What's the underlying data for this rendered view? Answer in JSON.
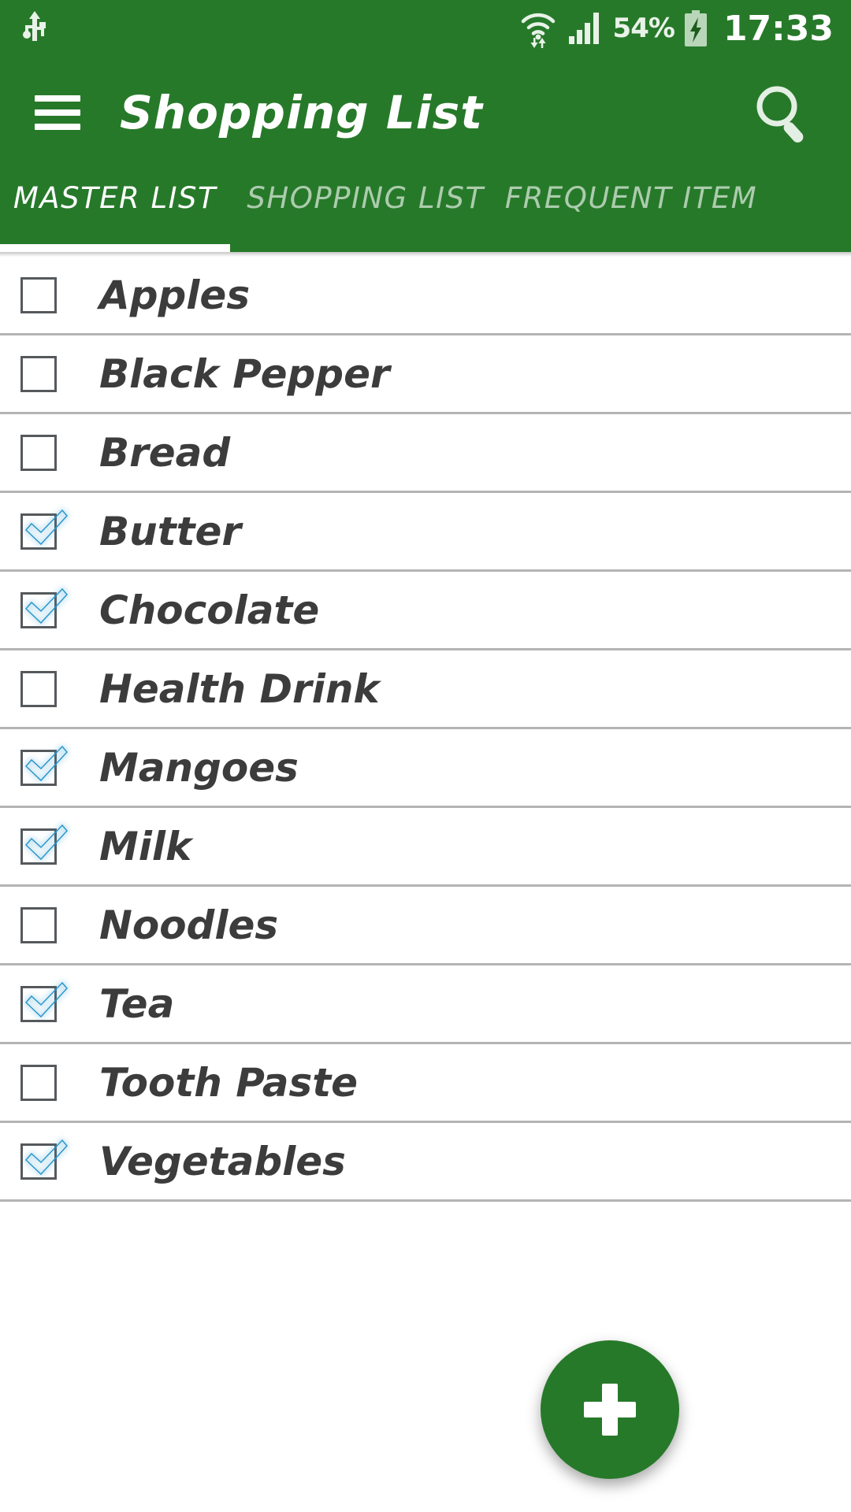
{
  "colors": {
    "brand_green": "#27792a",
    "check_blue": "#3bade3",
    "divider": "#b4b4b4",
    "text": "#3c3c3c"
  },
  "statusbar": {
    "usb_icon": "usb-icon",
    "wifi_icon": "wifi-icon",
    "signal_icon": "signal-bars-icon",
    "battery_percent": "54%",
    "battery_icon": "battery-charging-icon",
    "time": "17:33"
  },
  "appbar": {
    "menu_icon": "hamburger-menu-icon",
    "title": "Shopping List",
    "search_icon": "search-icon"
  },
  "tabs": [
    {
      "label": "MASTER LIST",
      "active": true
    },
    {
      "label": "SHOPPING LIST",
      "active": false
    },
    {
      "label": "FREQUENT ITEM",
      "active": false
    }
  ],
  "list": {
    "items": [
      {
        "label": "Apples",
        "checked": false
      },
      {
        "label": "Black Pepper",
        "checked": false
      },
      {
        "label": "Bread",
        "checked": false
      },
      {
        "label": "Butter",
        "checked": true
      },
      {
        "label": "Chocolate",
        "checked": true
      },
      {
        "label": "Health Drink",
        "checked": false
      },
      {
        "label": "Mangoes",
        "checked": true
      },
      {
        "label": "Milk",
        "checked": true
      },
      {
        "label": "Noodles",
        "checked": false
      },
      {
        "label": "Tea",
        "checked": true
      },
      {
        "label": "Tooth Paste",
        "checked": false
      },
      {
        "label": "Vegetables",
        "checked": true
      }
    ]
  },
  "fab": {
    "icon": "plus-icon",
    "label": "+"
  }
}
